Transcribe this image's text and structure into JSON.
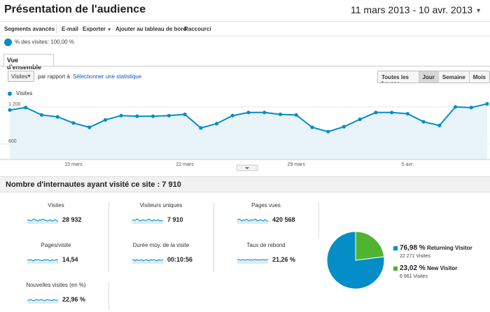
{
  "header": {
    "title": "Présentation de l'audience",
    "date_range": "11 mars 2013 - 10 avr. 2013"
  },
  "toolbar": {
    "segments": "Segments avancés",
    "email": "E-mail",
    "export": "Exporter",
    "add_dashboard": "Ajouter au tableau de bord",
    "shortcut": "Raccourci"
  },
  "segment": {
    "label": "% des visites: 100,00 %"
  },
  "tabs": {
    "overview": "Vue d'ensemble"
  },
  "chart_controls": {
    "metric": "Visites",
    "compare": "par rapport à",
    "select_stat": "Sélectionner une statistique",
    "granularity": [
      "Toutes les heures",
      "Jour",
      "Semaine",
      "Mois"
    ],
    "active": "Jour"
  },
  "chart_data": {
    "type": "area",
    "series": [
      {
        "name": "Visites",
        "values": [
          1150,
          1190,
          1070,
          1040,
          940,
          870,
          990,
          1060,
          1050,
          1050,
          1060,
          1080,
          860,
          930,
          1060,
          1110,
          1110,
          1080,
          1070,
          870,
          800,
          880,
          1000,
          1110,
          1110,
          1090,
          960,
          900,
          1200,
          1190,
          1250
        ]
      }
    ],
    "yticks": [
      "1 200",
      "600"
    ],
    "ylim": [
      350,
      1300
    ],
    "xticks": [
      {
        "label": "15 mars",
        "index": 4
      },
      {
        "label": "22 mars",
        "index": 11
      },
      {
        "label": "29 mars",
        "index": 18
      },
      {
        "label": "5 avr.",
        "index": 25
      }
    ],
    "color": "#058dc7",
    "fill": "#e8f4fa"
  },
  "summary": {
    "title": "Nombre d'internautes ayant visité ce site : 7 910"
  },
  "metrics": [
    {
      "label": "Visites",
      "value": "28 932"
    },
    {
      "label": "Visiteurs uniques",
      "value": "7 910"
    },
    {
      "label": "Pages vues",
      "value": "420 568"
    },
    {
      "label": "Pages/visite",
      "value": "14,54"
    },
    {
      "label": "Durée moy. de la visite",
      "value": "00:10:56"
    },
    {
      "label": "Taux de rebond",
      "value": "21,26 %"
    },
    {
      "label": "Nouvelles visites (en %)",
      "value": "22,96 %"
    }
  ],
  "pie": {
    "slices": [
      {
        "pct_label": "76,98 %",
        "name": "Returning Visitor",
        "sub": "22 271 Visites",
        "value": 76.98,
        "color": "#058dc7"
      },
      {
        "pct_label": "23,02 %",
        "name": "New Visitor",
        "sub": "6 661 Visites",
        "value": 23.02,
        "color": "#50b432"
      }
    ]
  }
}
